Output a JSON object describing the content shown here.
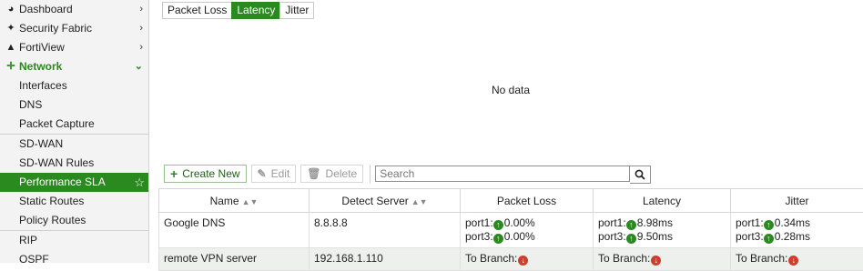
{
  "sidebar": {
    "items": [
      {
        "label": "Dashboard",
        "icon": "dashboard-icon"
      },
      {
        "label": "Security Fabric",
        "icon": "security-fabric-icon"
      },
      {
        "label": "FortiView",
        "icon": "chart-icon"
      },
      {
        "label": "Network",
        "icon": "network-icon"
      },
      {
        "label": "Interfaces"
      },
      {
        "label": "DNS"
      },
      {
        "label": "Packet Capture"
      },
      {
        "label": "SD-WAN"
      },
      {
        "label": "SD-WAN Rules"
      },
      {
        "label": "Performance SLA"
      },
      {
        "label": "Static Routes"
      },
      {
        "label": "Policy Routes"
      },
      {
        "label": "RIP"
      },
      {
        "label": "OSPF"
      }
    ]
  },
  "chart_tabs": [
    "Packet Loss",
    "Latency",
    "Jitter"
  ],
  "active_chart_tab": "Latency",
  "chart_message": "No data",
  "toolbar": {
    "create_label": "Create New",
    "edit_label": "Edit",
    "delete_label": "Delete",
    "search_placeholder": "Search"
  },
  "table": {
    "columns": [
      "Name",
      "Detect Server",
      "Packet Loss",
      "Latency",
      "Jitter"
    ],
    "rows": [
      {
        "name": "Google DNS",
        "server": "8.8.8.8",
        "loss": [
          {
            "port": "port1:",
            "value": "0.00%"
          },
          {
            "port": "port3:",
            "value": "0.00%"
          }
        ],
        "latency": [
          {
            "port": "port1:",
            "value": "8.98ms"
          },
          {
            "port": "port3:",
            "value": "9.50ms"
          }
        ],
        "jitter": [
          {
            "port": "port1:",
            "value": "0.34ms"
          },
          {
            "port": "port3:",
            "value": "0.28ms"
          }
        ]
      },
      {
        "name": "remote VPN server",
        "server": "192.168.1.110",
        "loss": "To Branch:",
        "latency": "To Branch:",
        "jitter": "To Branch:"
      }
    ]
  },
  "colors": {
    "accent": "#2b8a1f",
    "down": "#d23c2a"
  }
}
